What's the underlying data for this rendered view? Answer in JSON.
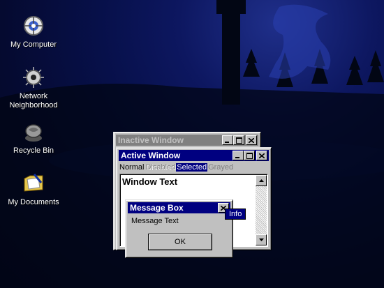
{
  "desktop": {
    "icons": [
      {
        "label": "My Computer",
        "icon": "my-computer-icon"
      },
      {
        "label": "Network\nNeighborhood",
        "icon": "network-neighborhood-icon"
      },
      {
        "label": "Recycle Bin",
        "icon": "recycle-bin-icon"
      },
      {
        "label": "My Documents",
        "icon": "my-documents-icon"
      }
    ],
    "colors": {
      "background": "#07104a",
      "active_title": "#000080",
      "inactive_title": "#808080",
      "face": "#c0c0c0"
    }
  },
  "inactive_window": {
    "title": "Inactive Window"
  },
  "active_window": {
    "title": "Active Window",
    "menu": {
      "normal": "Normal",
      "disabled": "Disabled",
      "selected": "Selected",
      "grayed": "Grayed"
    },
    "window_text": "Window Text"
  },
  "message_box": {
    "title": "Message Box",
    "text": "Message Text",
    "ok_label": "OK",
    "tooltip": "Info"
  }
}
